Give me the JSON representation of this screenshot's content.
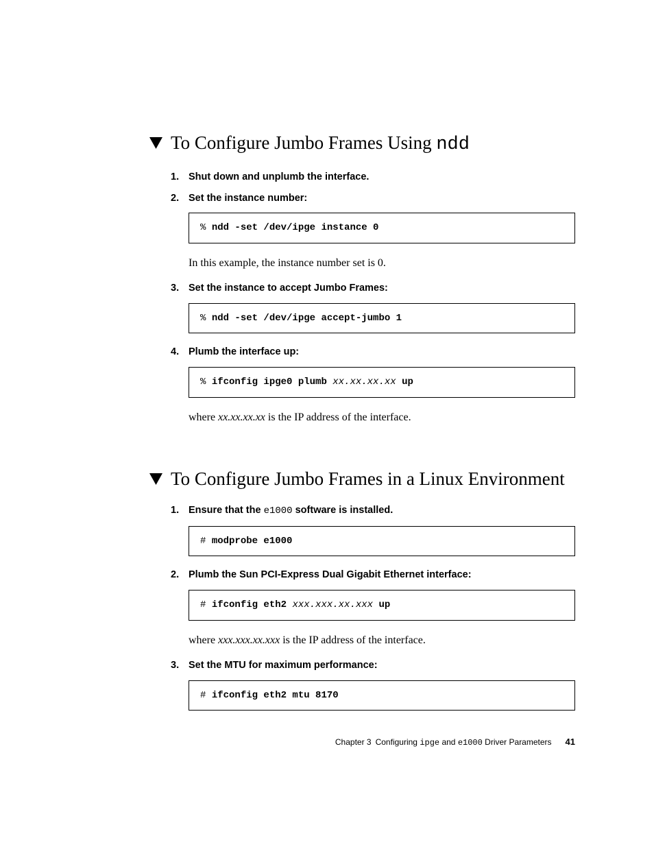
{
  "section1": {
    "title_pre": "To Configure Jumbo Frames Using ",
    "title_mono": "ndd",
    "steps": [
      {
        "num": "1.",
        "text": "Shut down and unplumb the interface."
      },
      {
        "num": "2.",
        "text": "Set the instance number:"
      }
    ],
    "code1": {
      "prompt": "% ",
      "cmd": "ndd -set /dev/ipge instance 0"
    },
    "para1": "In this example, the instance number set is 0.",
    "step3": {
      "num": "3.",
      "text": "Set the instance to accept Jumbo Frames:"
    },
    "code2": {
      "prompt": "% ",
      "cmd": "ndd -set /dev/ipge accept-jumbo 1"
    },
    "step4": {
      "num": "4.",
      "text": "Plumb the interface up:"
    },
    "code3": {
      "prompt": "% ",
      "cmd1": "ifconfig ipge0 plumb ",
      "arg": "xx.xx.xx.xx",
      "cmd2": " up"
    },
    "para2_pre": "where ",
    "para2_ital": "xx.xx.xx.xx",
    "para2_post": " is the IP address of the interface."
  },
  "section2": {
    "title": "To Configure Jumbo Frames in a Linux Environment",
    "step1": {
      "num": "1.",
      "pre": "Ensure that the ",
      "mono": "e1000",
      "post": " software is installed."
    },
    "code1": {
      "prompt": "# ",
      "cmd": "modprobe e1000"
    },
    "step2": {
      "num": "2.",
      "text": "Plumb the Sun PCI-Express Dual Gigabit Ethernet interface:"
    },
    "code2": {
      "prompt": "# ",
      "cmd1": "ifconfig eth2 ",
      "arg": "xxx.xxx.xx.xxx",
      "cmd2": " up"
    },
    "para1_pre": "where ",
    "para1_ital": "xxx.xxx.xx.xxx",
    "para1_post": " is the IP address of the interface.",
    "step3": {
      "num": "3.",
      "text": "Set the MTU for maximum performance:"
    },
    "code3": {
      "prompt": "# ",
      "cmd": "ifconfig eth2 mtu 8170"
    }
  },
  "footer": {
    "chapter": "Chapter 3",
    "title_pre": "Configuring ",
    "mono1": "ipge",
    "mid": " and ",
    "mono2": "e1000",
    "title_post": " Driver Parameters",
    "page": "41"
  }
}
